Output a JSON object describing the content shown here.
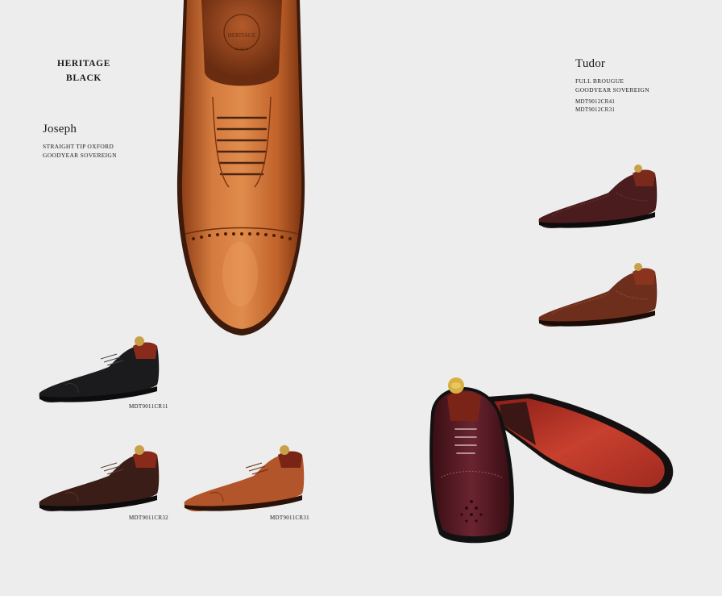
{
  "brand": {
    "line1": "HERITAGE",
    "line2": "BLACK"
  },
  "hero_stamp": {
    "line1": "HERITAGE",
    "line2": "BLACK"
  },
  "joseph": {
    "name": "Joseph",
    "spec_line1": "STRAIGHT TIP OXFORD",
    "spec_line2": "GOODYEAR SOVEREIGN",
    "variants": [
      {
        "code": "MDT9011CR11",
        "color": "#1b1b1e"
      },
      {
        "code": "MDT9011CR32",
        "color": "#3a1d16"
      },
      {
        "code": "MDT9011CR31",
        "color": "#b2552a"
      }
    ]
  },
  "tudor": {
    "name": "Tudor",
    "spec_line1": "FULL BROUGUE",
    "spec_line2": "GOODYEAR SOVEREIGN",
    "codes": [
      "MDT9012CR41",
      "MDT9012CR31"
    ],
    "colors": [
      "#4a1c1e",
      "#6e2e1c"
    ]
  },
  "colors": {
    "background": "#ededed",
    "hero_leather": "#c4642e",
    "sole_red": "#b8352a",
    "burgundy": "#5a1a22"
  }
}
